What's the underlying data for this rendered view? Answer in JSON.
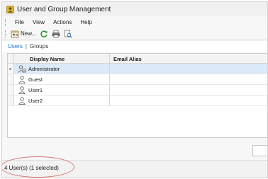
{
  "window": {
    "title": "User and Group Management"
  },
  "menu": [
    "File",
    "View",
    "Actions",
    "Help"
  ],
  "toolbar": {
    "new_label": "New..."
  },
  "view_tabs": {
    "users": "Users",
    "separator": "|",
    "groups": "Groups"
  },
  "grid": {
    "columns": [
      "Display Name",
      "Email Alias"
    ],
    "rows": [
      {
        "name": "Administrator",
        "email": "",
        "icon": "admin-user-icon",
        "selected": true
      },
      {
        "name": "Guest",
        "email": "",
        "icon": "user-icon"
      },
      {
        "name": "User1",
        "email": "",
        "icon": "user-icon"
      },
      {
        "name": "User2",
        "email": "",
        "icon": "user-icon"
      }
    ]
  },
  "status": {
    "text": "4 User(s) (1 selected)"
  },
  "colors": {
    "accent": "#1e6fd0",
    "selection": "#dbe9f8",
    "annotation": "#d47a76"
  }
}
